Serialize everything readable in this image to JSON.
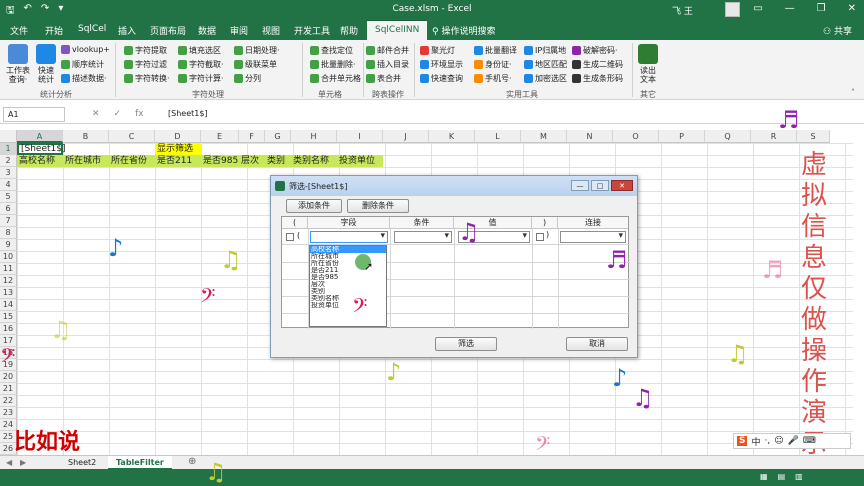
{
  "window": {
    "title": "Case.xlsm - Excel",
    "user": "飞 王",
    "share": "共享"
  },
  "ribbon_tabs": [
    "文件",
    "开始",
    "SqlCel",
    "插入",
    "页面布局",
    "数据",
    "审阅",
    "视图",
    "开发工具",
    "帮助",
    "SqlCelINN"
  ],
  "tell_me": "操作说明搜索",
  "ribbon": {
    "big": [
      {
        "label1": "工作表",
        "label2": "查询·",
        "color": "#4a8ad6"
      },
      {
        "label1": "快速",
        "label2": "统计",
        "color": "#1e88e5"
      }
    ],
    "col1": [
      "vlookup+",
      "顺序统计",
      "描述数据·"
    ],
    "col2": [
      "字符提取",
      "字符过滤",
      "字符转换·"
    ],
    "col3": [
      "填充选区",
      "字符截取·",
      "字符计算·"
    ],
    "col4": [
      "日期处理·",
      "级联菜单",
      "分列"
    ],
    "col5": [
      "查找定位",
      "批量删除·",
      "合并单元格"
    ],
    "col6": [
      "邮件合并",
      "插入目录",
      "表合并"
    ],
    "col7": [
      "聚光灯",
      "环境显示",
      "快速查询"
    ],
    "col8": [
      "批量翻译",
      "身份证·",
      "手机号·"
    ],
    "col9": [
      "IP归属地",
      "地区匹配",
      "加密选区"
    ],
    "col10": [
      "破解密码·",
      "生成二维码",
      "生成条形码"
    ],
    "big_right": {
      "label1": "读出",
      "label2": "文本",
      "color": "#2e7d32"
    },
    "groups": [
      "统计分析",
      "字符处理",
      "单元格",
      "跨表操作",
      "实用工具",
      "其它"
    ]
  },
  "formula_bar": {
    "name_box": "A1",
    "formula": "[Sheet1$]"
  },
  "columns": [
    "A",
    "B",
    "C",
    "D",
    "E",
    "F",
    "G",
    "H",
    "I",
    "J",
    "K",
    "L",
    "M",
    "N",
    "O",
    "P",
    "Q",
    "R",
    "S"
  ],
  "rows": [
    "1",
    "2",
    "3",
    "4",
    "5",
    "6",
    "7",
    "8",
    "9",
    "10",
    "11",
    "12",
    "13",
    "14",
    "15",
    "16",
    "17",
    "18",
    "19",
    "20",
    "21",
    "22",
    "23",
    "24",
    "25",
    "26"
  ],
  "cells": {
    "a1": "[Sheet1$]",
    "d1": "显示筛选",
    "row2": [
      "高校名称",
      "所在城市",
      "所在省份",
      "是否211",
      "是否985",
      "层次",
      "类别",
      "类别名称",
      "投资单位"
    ]
  },
  "sheet_tabs": [
    "Sheet2",
    "TableFilter"
  ],
  "dialog": {
    "title": "筛选-[Sheet1$]",
    "add_button": "添加条件",
    "delete_button": "删除条件",
    "headers": [
      "(",
      "字段",
      "条件",
      "值",
      ")",
      "连接"
    ],
    "row1_paren": "(",
    "dropdown_items": [
      "高校名称",
      "所在城市",
      "所在省份",
      "是否211",
      "是否985",
      "层次",
      "类别",
      "类别名称",
      "投资单位"
    ],
    "filter_button": "筛选",
    "cancel_button": "取消"
  },
  "overlay": {
    "vertical_text": "虚拟信息仅做操作演示",
    "caption": "比如说",
    "ime": "中"
  },
  "colors": {
    "excel_green": "#217346",
    "header_yellow": "#ffff00",
    "row_green": "#c6e85a",
    "note_red": "#d9534f"
  }
}
